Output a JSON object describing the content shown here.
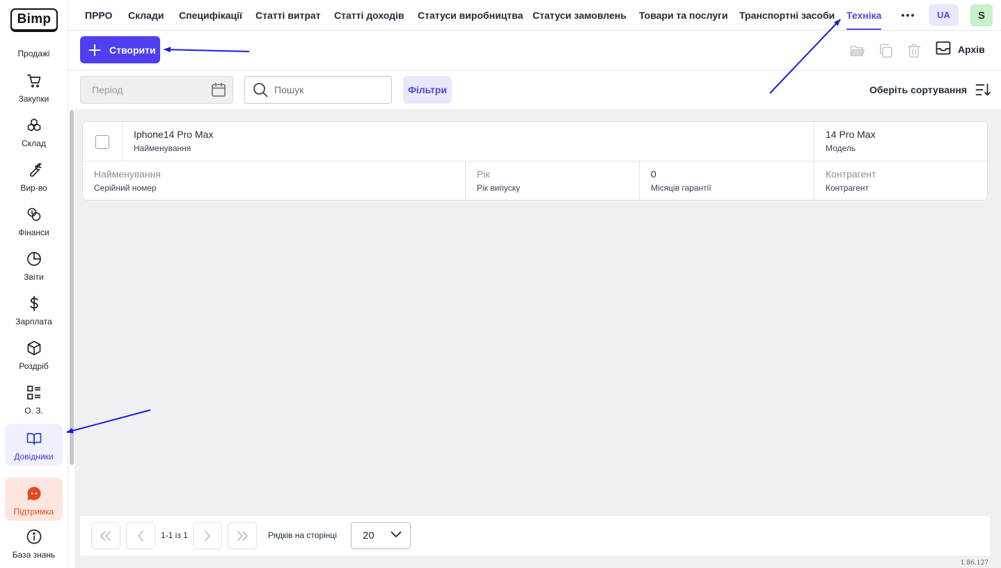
{
  "logo": {
    "text": "Bimp"
  },
  "sidebar": {
    "items": [
      {
        "label": "Продажі",
        "icon": "none"
      },
      {
        "label": "Закупки",
        "icon": "cart-icon"
      },
      {
        "label": "Склад",
        "icon": "boxes-icon"
      },
      {
        "label": "Вир-во",
        "icon": "wrench-icon"
      },
      {
        "label": "Фінанси",
        "icon": "coins-icon"
      },
      {
        "label": "Звіти",
        "icon": "pie-chart-icon"
      },
      {
        "label": "Зарплата",
        "icon": "dollar-icon"
      },
      {
        "label": "Роздріб",
        "icon": "cube-icon"
      },
      {
        "label": "О. З.",
        "icon": "checklist-icon"
      },
      {
        "label": "Довідники",
        "icon": "book-icon",
        "active": true
      },
      {
        "label": "Підтримка",
        "icon": "chat-icon"
      },
      {
        "label": "База знань",
        "icon": "info-icon"
      }
    ]
  },
  "topnav": {
    "tabs": [
      {
        "label": "ПРРО"
      },
      {
        "label": "Склади"
      },
      {
        "label": "Специфікації"
      },
      {
        "label": "Статті витрат"
      },
      {
        "label": "Статті доходів"
      },
      {
        "label": "Статуси виробництва"
      },
      {
        "label": "Статуси замовлень"
      },
      {
        "label": "Товари та послуги"
      },
      {
        "label": "Транспортні засоби"
      },
      {
        "label": "Техніка",
        "active": true
      }
    ],
    "language": "UA",
    "user_initial": "S"
  },
  "toolbar": {
    "create_label": "Створити",
    "archive_label": "Архів"
  },
  "filters": {
    "period_placeholder": "Період",
    "search_placeholder": "Пошук",
    "filters_label": "Фільтри",
    "sort_label": "Оберіть сортування"
  },
  "record": {
    "name": {
      "value": "Iphone14 Pro Max",
      "label": "Найменування"
    },
    "model": {
      "value": "14 Pro Max",
      "label": "Модель"
    },
    "serial": {
      "value": "Найменування",
      "label": "Серійний номер"
    },
    "year": {
      "value": "Рік",
      "label": "Рік випуску"
    },
    "warranty": {
      "value": "0",
      "label": "Місяців гарантії"
    },
    "counterparty": {
      "value": "Контрагент",
      "label": "Контрагент"
    }
  },
  "pagination": {
    "range": "1-1 із 1",
    "rows_label": "Рядків на сторінці",
    "rows_per_page": "20"
  },
  "version": "1.86.127",
  "colors": {
    "accent": "#4f3ff0",
    "active_tab": "#4f46e5",
    "support_bg": "#fde6df",
    "annotation_arrow": "#1a1ae6"
  }
}
